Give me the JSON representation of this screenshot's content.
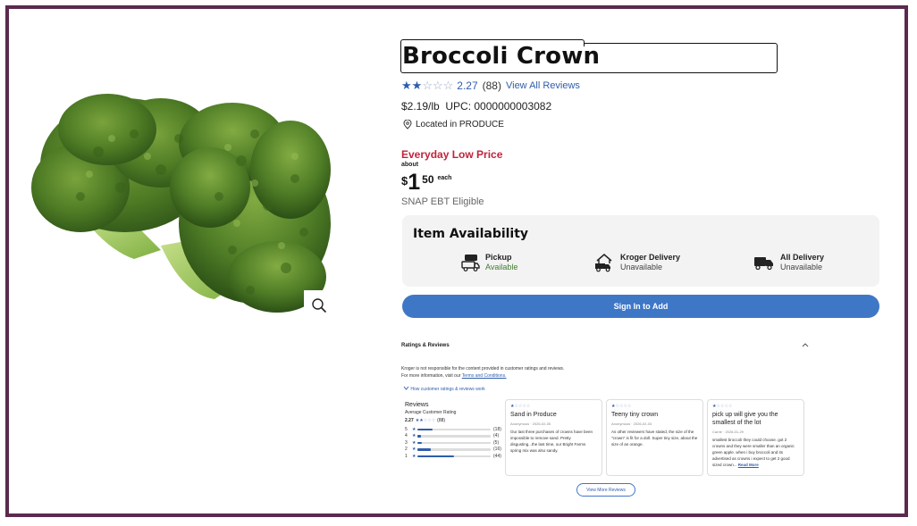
{
  "product": {
    "title": "Broccoli Crown",
    "rating_value": "2.27",
    "rating_count": "(88)",
    "view_all_reviews": "View All Reviews",
    "unit_price": "$2.19/lb",
    "upc": "UPC: 0000000003082",
    "location": "Located in PRODUCE",
    "edlp_label": "Everyday Low Price",
    "about": "about",
    "price_currency": "$",
    "price_whole": "1",
    "price_cents": "50",
    "price_unit": "each",
    "snap": "SNAP EBT Eligible",
    "rating_stars": 2
  },
  "availability": {
    "title": "Item Availability",
    "options": [
      {
        "label": "Pickup",
        "status": "Available",
        "icon": "pickup-truck-icon"
      },
      {
        "label": "Kroger Delivery",
        "status": "Unavailable",
        "icon": "home-delivery-icon"
      },
      {
        "label": "All Delivery",
        "status": "Unavailable",
        "icon": "delivery-truck-icon"
      }
    ]
  },
  "actions": {
    "sign_in": "Sign In to Add",
    "view_more_reviews": "View More Reviews"
  },
  "ratings_section": {
    "header": "Ratings & Reviews",
    "disclaimer_line1": "Kroger is not responsible for the content provided in customer ratings and reviews.",
    "disclaimer_line2_prefix": "For more information, visit our",
    "terms_link": "Terms and Conditions.",
    "how_link": "How customer ratings & reviews work",
    "reviews_title": "Reviews",
    "avg_label": "Average Customer Rating",
    "avg_value": "2.27",
    "avg_count": "(88)",
    "distribution": [
      {
        "stars": "5",
        "count": "(18)",
        "fraction": 0.205
      },
      {
        "stars": "4",
        "count": "(4)",
        "fraction": 0.045
      },
      {
        "stars": "3",
        "count": "(5)",
        "fraction": 0.057
      },
      {
        "stars": "2",
        "count": "(16)",
        "fraction": 0.182
      },
      {
        "stars": "1",
        "count": "(44)",
        "fraction": 0.5
      }
    ]
  },
  "reviews": [
    {
      "stars": 1,
      "title": "Sand in Produce",
      "meta": "Anonymous · 2026-02-05",
      "body": "Our last three purchases of crowns have been impossible to remove sand. Pretty disgusting...the last time, our Bright Farms spring mix was also sandy."
    },
    {
      "stars": 1,
      "title": "Teeny tiny crown",
      "meta": "Anonymous · 2026-02-03",
      "body": "As other reviewers have stated, the size of the \"crown\" is fit for a doll. Super tiny size, about the size of an orange."
    },
    {
      "stars": 1,
      "title": "pick up will give you the smallest of the lot",
      "meta": "Carrie · 2026-01-29",
      "body": "smallest broccoli they could choose. got 2 crowns and they were smaller than an organic green apple. when i buy broccoli and its advertised as crowns i expect to get 2 good sized crown...",
      "read_more": "Read More"
    }
  ],
  "colors": {
    "frame": "#5b2a4e",
    "accent_blue": "#3f77c7",
    "price_red": "#c1233b",
    "available_green": "#3e7d2c"
  }
}
